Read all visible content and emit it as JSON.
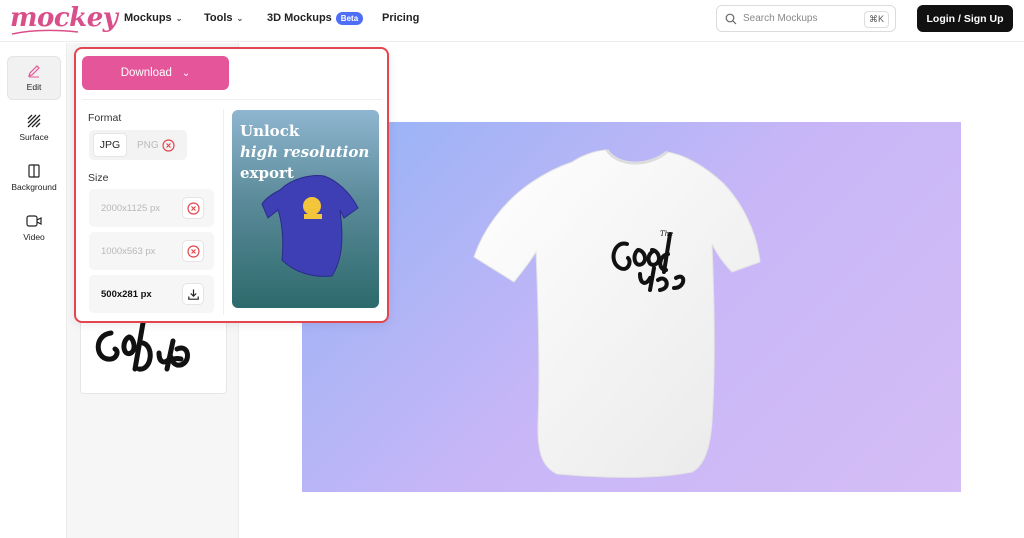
{
  "brand": {
    "logo_text": "mockey"
  },
  "nav": {
    "mockups": "Mockups",
    "tools": "Tools",
    "mockups3d": "3D Mockups",
    "beta_badge": "Beta",
    "pricing": "Pricing"
  },
  "search": {
    "placeholder": "Search Mockups",
    "shortcut": "⌘K"
  },
  "auth": {
    "login_label": "Login / Sign Up"
  },
  "rail": [
    {
      "label": "Edit",
      "icon": "pencil-icon"
    },
    {
      "label": "Surface",
      "icon": "hatch-icon"
    },
    {
      "label": "Background",
      "icon": "background-icon"
    },
    {
      "label": "Video",
      "icon": "video-camera-icon"
    }
  ],
  "download": {
    "button_label": "Download",
    "format_label": "Format",
    "formats": [
      {
        "label": "JPG",
        "selected": true
      },
      {
        "label": "PNG",
        "locked": true
      }
    ],
    "size_label": "Size",
    "sizes": [
      {
        "label": "2000x1125 px",
        "locked": true
      },
      {
        "label": "1000x563 px",
        "locked": true
      },
      {
        "label": "500x281 px",
        "locked": false
      }
    ],
    "promo": {
      "line1": "Unlock",
      "line2": "high resolution",
      "line3": "export"
    }
  },
  "colors": {
    "brand_pink": "#e5559a",
    "highlight_red": "#e2474f",
    "beta_blue": "#4f6ef7"
  }
}
